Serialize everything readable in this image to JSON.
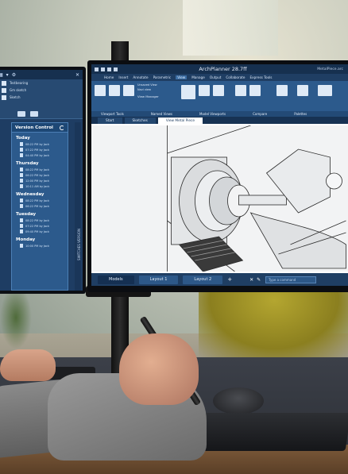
{
  "right_monitor": {
    "app_title": "ArchPlanner 28.7ff",
    "file_name": "MetalPiece.arc",
    "menu_tabs": [
      "Home",
      "Insert",
      "Annotate",
      "Parametric",
      "View",
      "Manage",
      "Output",
      "Collaborate",
      "Express Tools"
    ],
    "active_menu": "View",
    "ribbon_small": [
      "Unsaved View",
      "Navi view",
      "View Manager"
    ],
    "panel_labels": [
      "Viewport Tools",
      "Named Views",
      "Model Viewports",
      "Compare",
      "Palettes"
    ],
    "doc_tabs": [
      "Start",
      "Sketches",
      "View Metal Piece"
    ],
    "layout_tabs": [
      "Models",
      "Layout 1",
      "Layout 2"
    ],
    "command_placeholder": "Type a command"
  },
  "left_monitor": {
    "files": [
      "Testbearing",
      "Gm sketch",
      "Sketch"
    ],
    "version_control": {
      "title": "Version Control",
      "groups": [
        {
          "day": "Today",
          "entries": [
            "08:22 PM by Jack",
            "07:22 PM by Jack",
            "04:40 PM by Jack"
          ]
        },
        {
          "day": "Thursday",
          "entries": [
            "08:22 PM by Jack",
            "06:22 PM by Jack",
            "12:00 PM by Jack",
            "10:11 AM by Jack"
          ]
        },
        {
          "day": "Wednesday",
          "entries": [
            "08:22 PM by Jack",
            "06:22 PM by Jack"
          ]
        },
        {
          "day": "Tuesday",
          "entries": [
            "08:22 PM by Jack",
            "07:22 PM by Jack",
            "09:40 PM by Jack"
          ]
        },
        {
          "day": "Monday",
          "entries": [
            "10:00 PM by Jack"
          ]
        }
      ]
    },
    "side_label": "SWITCHES VERSION"
  }
}
